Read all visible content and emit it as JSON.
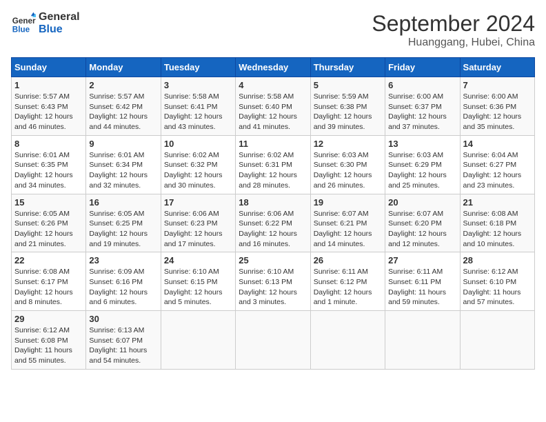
{
  "logo": {
    "line1": "General",
    "line2": "Blue"
  },
  "title": "September 2024",
  "location": "Huanggang, Hubei, China",
  "days_of_week": [
    "Sunday",
    "Monday",
    "Tuesday",
    "Wednesday",
    "Thursday",
    "Friday",
    "Saturday"
  ],
  "weeks": [
    [
      {
        "day": 1,
        "sunrise": "5:57 AM",
        "sunset": "6:43 PM",
        "daylight": "12 hours and 46 minutes."
      },
      {
        "day": 2,
        "sunrise": "5:57 AM",
        "sunset": "6:42 PM",
        "daylight": "12 hours and 44 minutes."
      },
      {
        "day": 3,
        "sunrise": "5:58 AM",
        "sunset": "6:41 PM",
        "daylight": "12 hours and 43 minutes."
      },
      {
        "day": 4,
        "sunrise": "5:58 AM",
        "sunset": "6:40 PM",
        "daylight": "12 hours and 41 minutes."
      },
      {
        "day": 5,
        "sunrise": "5:59 AM",
        "sunset": "6:38 PM",
        "daylight": "12 hours and 39 minutes."
      },
      {
        "day": 6,
        "sunrise": "6:00 AM",
        "sunset": "6:37 PM",
        "daylight": "12 hours and 37 minutes."
      },
      {
        "day": 7,
        "sunrise": "6:00 AM",
        "sunset": "6:36 PM",
        "daylight": "12 hours and 35 minutes."
      }
    ],
    [
      {
        "day": 8,
        "sunrise": "6:01 AM",
        "sunset": "6:35 PM",
        "daylight": "12 hours and 34 minutes."
      },
      {
        "day": 9,
        "sunrise": "6:01 AM",
        "sunset": "6:34 PM",
        "daylight": "12 hours and 32 minutes."
      },
      {
        "day": 10,
        "sunrise": "6:02 AM",
        "sunset": "6:32 PM",
        "daylight": "12 hours and 30 minutes."
      },
      {
        "day": 11,
        "sunrise": "6:02 AM",
        "sunset": "6:31 PM",
        "daylight": "12 hours and 28 minutes."
      },
      {
        "day": 12,
        "sunrise": "6:03 AM",
        "sunset": "6:30 PM",
        "daylight": "12 hours and 26 minutes."
      },
      {
        "day": 13,
        "sunrise": "6:03 AM",
        "sunset": "6:29 PM",
        "daylight": "12 hours and 25 minutes."
      },
      {
        "day": 14,
        "sunrise": "6:04 AM",
        "sunset": "6:27 PM",
        "daylight": "12 hours and 23 minutes."
      }
    ],
    [
      {
        "day": 15,
        "sunrise": "6:05 AM",
        "sunset": "6:26 PM",
        "daylight": "12 hours and 21 minutes."
      },
      {
        "day": 16,
        "sunrise": "6:05 AM",
        "sunset": "6:25 PM",
        "daylight": "12 hours and 19 minutes."
      },
      {
        "day": 17,
        "sunrise": "6:06 AM",
        "sunset": "6:23 PM",
        "daylight": "12 hours and 17 minutes."
      },
      {
        "day": 18,
        "sunrise": "6:06 AM",
        "sunset": "6:22 PM",
        "daylight": "12 hours and 16 minutes."
      },
      {
        "day": 19,
        "sunrise": "6:07 AM",
        "sunset": "6:21 PM",
        "daylight": "12 hours and 14 minutes."
      },
      {
        "day": 20,
        "sunrise": "6:07 AM",
        "sunset": "6:20 PM",
        "daylight": "12 hours and 12 minutes."
      },
      {
        "day": 21,
        "sunrise": "6:08 AM",
        "sunset": "6:18 PM",
        "daylight": "12 hours and 10 minutes."
      }
    ],
    [
      {
        "day": 22,
        "sunrise": "6:08 AM",
        "sunset": "6:17 PM",
        "daylight": "12 hours and 8 minutes."
      },
      {
        "day": 23,
        "sunrise": "6:09 AM",
        "sunset": "6:16 PM",
        "daylight": "12 hours and 6 minutes."
      },
      {
        "day": 24,
        "sunrise": "6:10 AM",
        "sunset": "6:15 PM",
        "daylight": "12 hours and 5 minutes."
      },
      {
        "day": 25,
        "sunrise": "6:10 AM",
        "sunset": "6:13 PM",
        "daylight": "12 hours and 3 minutes."
      },
      {
        "day": 26,
        "sunrise": "6:11 AM",
        "sunset": "6:12 PM",
        "daylight": "12 hours and 1 minute."
      },
      {
        "day": 27,
        "sunrise": "6:11 AM",
        "sunset": "6:11 PM",
        "daylight": "11 hours and 59 minutes."
      },
      {
        "day": 28,
        "sunrise": "6:12 AM",
        "sunset": "6:10 PM",
        "daylight": "11 hours and 57 minutes."
      }
    ],
    [
      {
        "day": 29,
        "sunrise": "6:12 AM",
        "sunset": "6:08 PM",
        "daylight": "11 hours and 55 minutes."
      },
      {
        "day": 30,
        "sunrise": "6:13 AM",
        "sunset": "6:07 PM",
        "daylight": "11 hours and 54 minutes."
      },
      null,
      null,
      null,
      null,
      null
    ]
  ]
}
